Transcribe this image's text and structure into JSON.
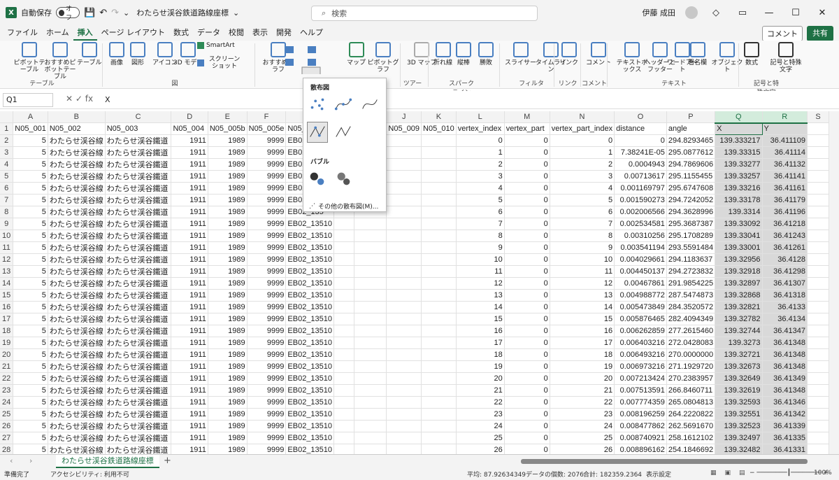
{
  "titlebar": {
    "autosave": "自動保存",
    "autosave_state": "オフ",
    "filename": "わたらせ渓谷鉄道路線座標",
    "search": "検索",
    "user": "伊藤 成田"
  },
  "menu": [
    "ファイル",
    "ホーム",
    "挿入",
    "ページ レイアウト",
    "数式",
    "データ",
    "校閲",
    "表示",
    "開発",
    "ヘルプ"
  ],
  "menu_right": {
    "comment": "コメント",
    "share": "共有"
  },
  "ribbon": {
    "buttons": [
      "ピボットテーブル",
      "おすすめピボットテーブル",
      "テーブル",
      "画像",
      "図形",
      "アイコン",
      "3D モデル",
      "SmartArt",
      "スクリーンショット",
      "おすすめグラフ",
      "マップ",
      "ピボットグラフ",
      "3D マップ",
      "折れ線",
      "縦棒",
      "勝敗",
      "スライサー",
      "タイムライン",
      "リンク",
      "コメント",
      "テキストボックス",
      "ヘッダーとフッター",
      "ワードアート",
      "署名欄",
      "オブジェクト",
      "数式",
      "記号と特殊文字"
    ],
    "groups": [
      "テーブル",
      "図",
      "ツアー",
      "スパークライン",
      "フィルター",
      "リンク",
      "コメント",
      "テキスト",
      "記号と特殊文字"
    ]
  },
  "formula": {
    "namebox": "Q1",
    "value": "X"
  },
  "popup": {
    "scatter_title": "散布図",
    "bubble_title": "バブル",
    "more": "その他の散布図(M)..."
  },
  "columns": [
    "A",
    "B",
    "C",
    "D",
    "E",
    "F",
    "G",
    "H",
    "I",
    "J",
    "K",
    "L",
    "M",
    "N",
    "O",
    "P",
    "Q",
    "R",
    "S"
  ],
  "header_row": [
    "N05_001",
    "N05_002",
    "N05_003",
    "N05_004",
    "N05_005b",
    "N05_005e",
    "N05_006",
    "",
    "",
    "N05_009",
    "N05_010",
    "vertex_index",
    "vertex_part",
    "vertex_part_index",
    "distance",
    "angle",
    "X",
    "Y",
    ""
  ],
  "rows": [
    [
      "0",
      "0",
      "0",
      "0",
      "294.8293465",
      "139.333217",
      "36.411109"
    ],
    [
      "1",
      "0",
      "1",
      "7.38241E-05",
      "295.0877612",
      "139.33315",
      "36.41114"
    ],
    [
      "2",
      "0",
      "2",
      "0.0004943",
      "294.7869606",
      "139.33277",
      "36.41132"
    ],
    [
      "3",
      "0",
      "3",
      "0.00713617",
      "295.1155455",
      "139.33257",
      "36.41141"
    ],
    [
      "4",
      "0",
      "4",
      "0.001169797",
      "295.6747608",
      "139.33216",
      "36.41161"
    ],
    [
      "5",
      "0",
      "5",
      "0.001590273",
      "294.7242052",
      "139.33178",
      "36.41179"
    ],
    [
      "6",
      "0",
      "6",
      "0.002006566",
      "294.3628996",
      "139.3314",
      "36.41196"
    ],
    [
      "7",
      "0",
      "7",
      "0.002534581",
      "295.3687387",
      "139.33092",
      "36.41218"
    ],
    [
      "8",
      "0",
      "8",
      "0.00310256",
      "295.1708289",
      "139.33041",
      "36.41243"
    ],
    [
      "9",
      "0",
      "9",
      "0.003541194",
      "293.5591484",
      "139.33001",
      "36.41261"
    ],
    [
      "10",
      "0",
      "10",
      "0.004029661",
      "294.1183637",
      "139.32956",
      "36.4128"
    ],
    [
      "11",
      "0",
      "11",
      "0.004450137",
      "294.2723832",
      "139.32918",
      "36.41298"
    ],
    [
      "12",
      "0",
      "12",
      "0.00467861",
      "291.9854225",
      "139.32897",
      "36.41307"
    ],
    [
      "13",
      "0",
      "13",
      "0.004988772",
      "287.5474873",
      "139.32868",
      "36.41318"
    ],
    [
      "14",
      "0",
      "14",
      "0.005473849",
      "284.3520572",
      "139.32821",
      "36.4133"
    ],
    [
      "15",
      "0",
      "15",
      "0.005876465",
      "282.4094349",
      "139.32782",
      "36.4134"
    ],
    [
      "16",
      "0",
      "16",
      "0.006262859",
      "277.2615460",
      "139.32744",
      "36.41347"
    ],
    [
      "17",
      "0",
      "17",
      "0.006403216",
      "272.0428083",
      "139.3273",
      "36.41348"
    ],
    [
      "18",
      "0",
      "18",
      "0.006493216",
      "270.0000000",
      "139.32721",
      "36.41348"
    ],
    [
      "19",
      "0",
      "19",
      "0.006973216",
      "271.1929720",
      "139.32673",
      "36.41348"
    ],
    [
      "20",
      "0",
      "20",
      "0.007213424",
      "270.2383957",
      "139.32649",
      "36.41349"
    ],
    [
      "21",
      "0",
      "21",
      "0.007513591",
      "266.8460711",
      "139.32619",
      "36.41348"
    ],
    [
      "22",
      "0",
      "22",
      "0.007774359",
      "265.0804813",
      "139.32593",
      "36.41346"
    ],
    [
      "23",
      "0",
      "23",
      "0.008196259",
      "264.2220822",
      "139.32551",
      "36.41342"
    ],
    [
      "24",
      "0",
      "24",
      "0.008477862",
      "262.5691670",
      "139.32523",
      "36.41339"
    ],
    [
      "25",
      "0",
      "25",
      "0.008740921",
      "258.1612102",
      "139.32497",
      "36.41335"
    ],
    [
      "26",
      "0",
      "26",
      "0.008896162",
      "254.1846692",
      "139.32482",
      "36.41331"
    ]
  ],
  "row_fixed": {
    "a": "5",
    "b": "わたらせ渓谷線",
    "c": "わたらせ渓谷鐵道",
    "d": "1911",
    "e": "1989",
    "f": "9999",
    "g1": "EB02_135",
    "g2": "EB02_13510"
  },
  "sheet_tab": "わたらせ渓谷鉄道路線座標",
  "status": {
    "ready": "準備完了",
    "accessibility": "アクセシビリティ: 利用不可",
    "average": "平均: 87.92634349",
    "count": "データの個数: 2076",
    "sum": "合計: 182359.2364",
    "display": "表示設定",
    "zoom": "100%"
  }
}
